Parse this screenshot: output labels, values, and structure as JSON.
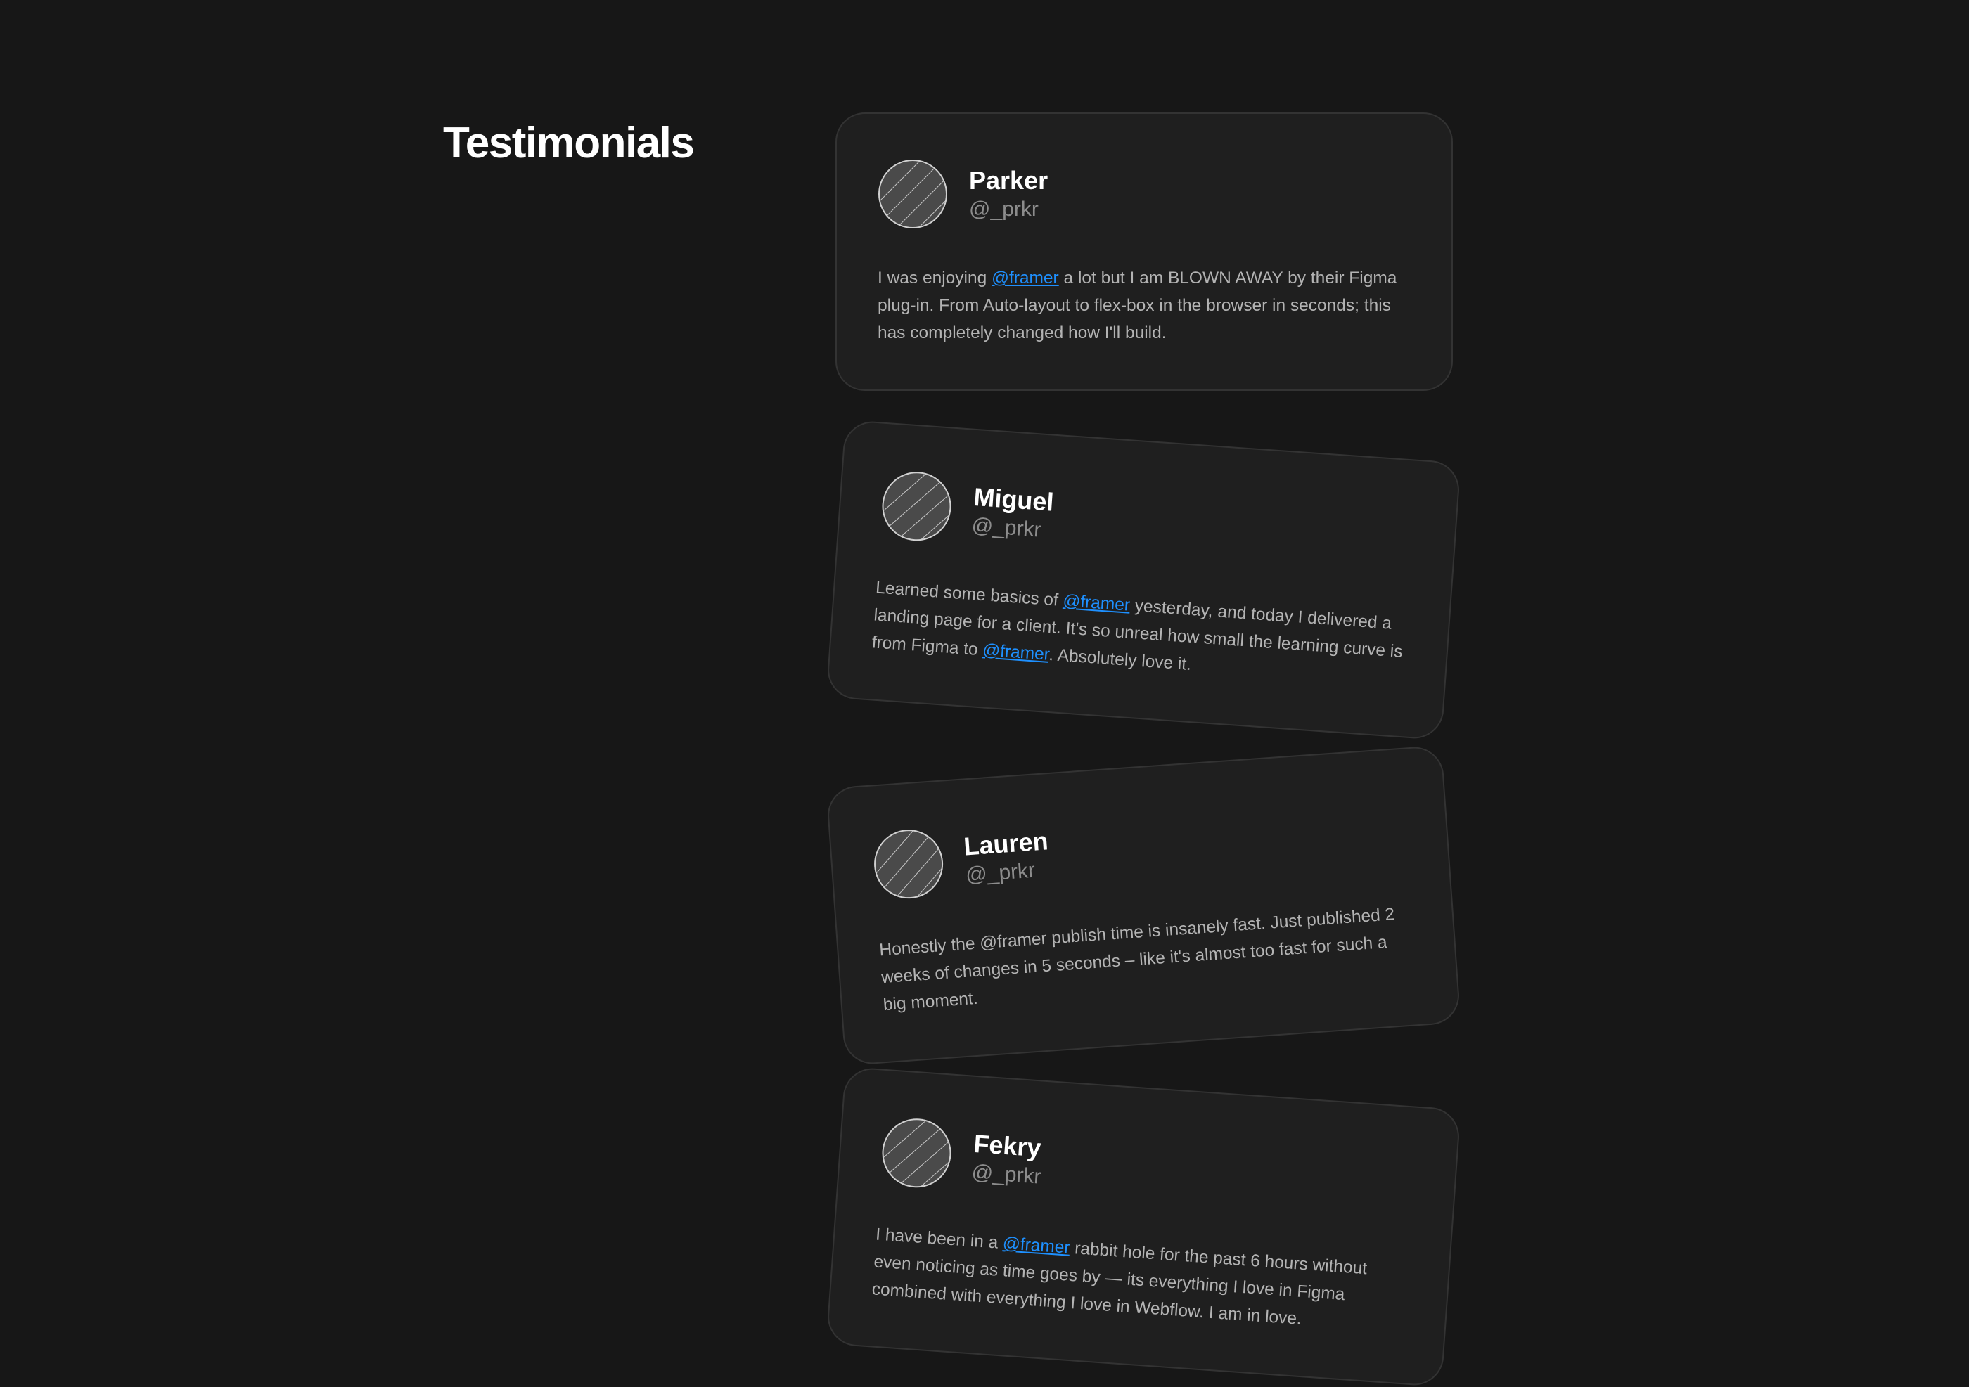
{
  "page": {
    "title": "Testimonials"
  },
  "theme": {
    "background": "#171717",
    "card_background": "#1f1f1f",
    "card_border": "#333333",
    "mention_color": "#1e90ff",
    "text_muted": "#b3b3b3"
  },
  "testimonials": [
    {
      "name": "Parker",
      "handle": "@_prkr",
      "avatar_icon": "hatched-circle-avatar",
      "quote": {
        "before": "I was enjoying ",
        "mention": "@framer",
        "after": " a lot but I am BLOWN AWAY by their Figma plug-in. From Auto-layout to flex-box in the browser in seconds; this has completely changed how I'll build."
      }
    },
    {
      "name": "Miguel",
      "handle": "@_prkr",
      "avatar_icon": "hatched-circle-avatar",
      "quote": {
        "before": "Learned some basics of ",
        "mention": "@framer",
        "middle": " yesterday, and today I delivered a landing page for a client. It's so unreal how small the learning curve is from Figma to ",
        "mention2": "@framer",
        "after": ". Absolutely love it."
      }
    },
    {
      "name": "Lauren",
      "handle": "@_prkr",
      "avatar_icon": "hatched-circle-avatar",
      "quote": {
        "text": "Honestly the @framer publish time is insanely fast. Just published 2 weeks of changes in 5 seconds – like it's almost too fast for such a big moment."
      }
    },
    {
      "name": "Fekry",
      "handle": "@_prkr",
      "avatar_icon": "hatched-circle-avatar",
      "quote": {
        "before": "I have been in a ",
        "mention": "@framer",
        "after": " rabbit hole for the past 6 hours without even noticing as time goes by — its everything I love in Figma combined with everything I love in Webflow. I am in love."
      }
    }
  ]
}
